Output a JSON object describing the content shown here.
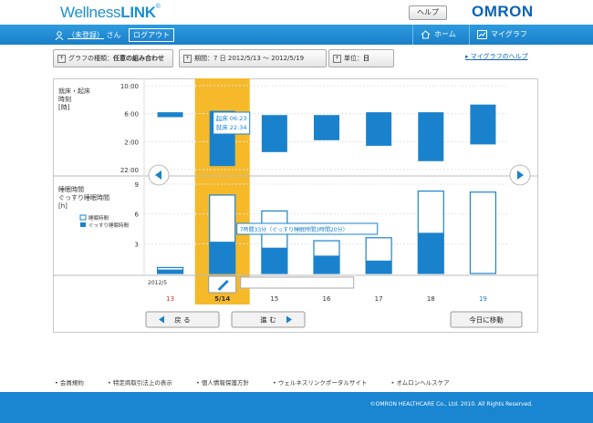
{
  "header": {
    "logo_part1": "Wellness",
    "logo_part2": "LINK",
    "logo_mark": "®",
    "help_label": "ヘルプ",
    "brand": "OMRON"
  },
  "topbar": {
    "user_name": "（未登録）",
    "user_suffix": "さん",
    "logout_label": "ログアウト",
    "nav": [
      {
        "label": "ホーム",
        "icon": "home-icon"
      },
      {
        "label": "マイグラフ",
        "icon": "graph-icon"
      }
    ]
  },
  "settings": {
    "graph_type_label": "グラフの種類：",
    "graph_type_value": "任意の組み合わせ",
    "period_label": "期間：",
    "period_value": "7 日  2012/5/13 〜 2012/5/19",
    "unit_label": "単位：",
    "unit_value": "日",
    "help_link": "マイグラフのヘルプ"
  },
  "chart_data": {
    "type": "bar",
    "categories": [
      "13",
      "5/14",
      "15",
      "16",
      "17",
      "18",
      "19"
    ],
    "month_label": "2012/5",
    "upper": {
      "label_lines": [
        "就床・起床",
        "時刻",
        "[時]"
      ],
      "y_ticks": [
        "10:00",
        "6:00",
        "2:00",
        "22:00"
      ],
      "ranges": [
        [
          5.5,
          6.2
        ],
        [
          22.5,
          6.4
        ],
        [
          0.5,
          5.8
        ],
        [
          2.2,
          5.8
        ],
        [
          1.4,
          6.2
        ],
        [
          23.2,
          6.2
        ],
        [
          1.6,
          7.3
        ]
      ]
    },
    "lower": {
      "label_lines": [
        "睡眠時間",
        "ぐっすり睡眠時間",
        "[h]"
      ],
      "y_ticks": [
        "9",
        "6",
        "3"
      ],
      "ylim": [
        0,
        9
      ],
      "legend": [
        "睡眠時間",
        "ぐっすり睡眠時間"
      ],
      "sleep_hours": [
        0.6,
        7.9,
        6.3,
        3.3,
        3.6,
        8.3,
        8.2
      ],
      "deep_sleep_hours": [
        0.4,
        3.2,
        2.6,
        1.8,
        1.3,
        4.1,
        0
      ]
    },
    "selected_index": 1,
    "tooltip_upper": [
      "起床 06:23",
      "就床 22:34"
    ],
    "tooltip_lower": "7時間33分（ぐっすり睡眠時間3時間20分）",
    "colors": {
      "bar": "#1a82cc",
      "highlight": "#f5b92a",
      "outline": "#1a82cc",
      "red_day": "#d9312b",
      "blue_day": "#1a82cc"
    }
  },
  "chart_nav": {
    "back_label": "戻 る",
    "next_label": "進 む",
    "today_label": "今日に移動"
  },
  "footer": {
    "links": [
      "会員規約",
      "特定商取引法上の表示",
      "個人情報保護方針",
      "ウェルネスリンクポータルサイト",
      "オムロンヘルスケア"
    ],
    "copyright": "©OMRON HEALTHCARE Co., Ltd. 2010. All Rights Reserved."
  }
}
